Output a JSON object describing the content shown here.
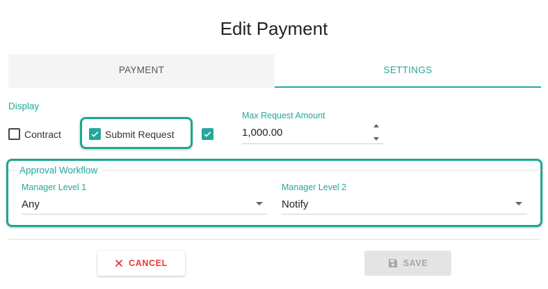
{
  "dialog": {
    "title": "Edit Payment"
  },
  "tabs": [
    {
      "label": "PAYMENT",
      "active": false
    },
    {
      "label": "SETTINGS",
      "active": true
    }
  ],
  "display": {
    "section_label": "Display",
    "contract_label": "Contract",
    "contract_checked": false,
    "submit_request_label": "Submit Request",
    "submit_request_checked": true,
    "extra_checked": true
  },
  "max_request": {
    "label": "Max Request Amount",
    "value": "1,000.00"
  },
  "approval_workflow": {
    "legend": "Approval Workflow",
    "manager_level_1": {
      "label": "Manager Level 1",
      "value": "Any"
    },
    "manager_level_2": {
      "label": "Manager Level 2",
      "value": "Notify"
    }
  },
  "actions": {
    "cancel_label": "CANCEL",
    "save_label": "SAVE",
    "save_disabled": true
  },
  "colors": {
    "accent": "#26a69a",
    "highlight": "#1aa88f",
    "cancel": "#e53935",
    "disabled": "#a6a6a6"
  }
}
